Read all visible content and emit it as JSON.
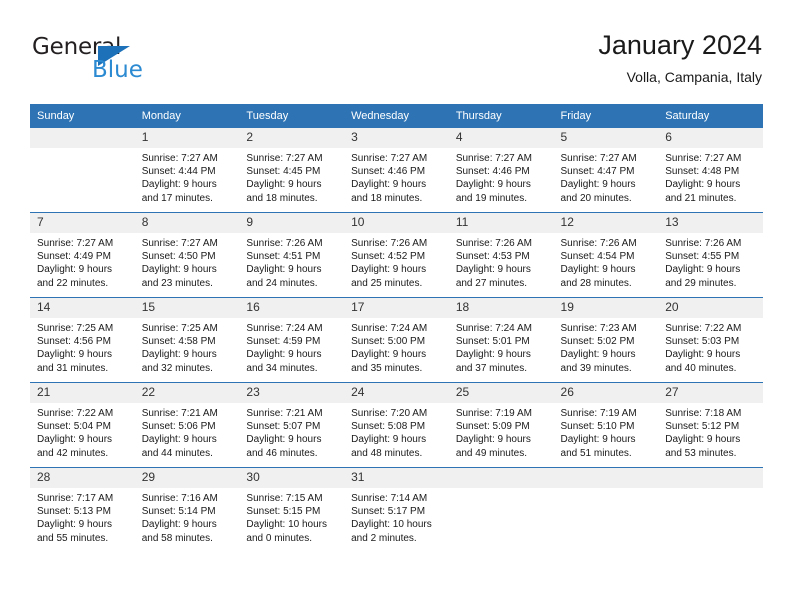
{
  "logo": {
    "word_one": "General",
    "word_two": "Blue",
    "triangle_color": "#1d71b8",
    "blue_color": "#2b8ad1"
  },
  "header": {
    "title": "January 2024",
    "subtitle": "Volla, Campania, Italy",
    "header_bg": "#2e74b5",
    "daynum_bg": "#f0f0f0"
  },
  "weekdays": [
    "Sunday",
    "Monday",
    "Tuesday",
    "Wednesday",
    "Thursday",
    "Friday",
    "Saturday"
  ],
  "weeks": [
    [
      {
        "day": "",
        "lines": []
      },
      {
        "day": "1",
        "lines": [
          "Sunrise: 7:27 AM",
          "Sunset: 4:44 PM",
          "Daylight: 9 hours",
          "and 17 minutes."
        ]
      },
      {
        "day": "2",
        "lines": [
          "Sunrise: 7:27 AM",
          "Sunset: 4:45 PM",
          "Daylight: 9 hours",
          "and 18 minutes."
        ]
      },
      {
        "day": "3",
        "lines": [
          "Sunrise: 7:27 AM",
          "Sunset: 4:46 PM",
          "Daylight: 9 hours",
          "and 18 minutes."
        ]
      },
      {
        "day": "4",
        "lines": [
          "Sunrise: 7:27 AM",
          "Sunset: 4:46 PM",
          "Daylight: 9 hours",
          "and 19 minutes."
        ]
      },
      {
        "day": "5",
        "lines": [
          "Sunrise: 7:27 AM",
          "Sunset: 4:47 PM",
          "Daylight: 9 hours",
          "and 20 minutes."
        ]
      },
      {
        "day": "6",
        "lines": [
          "Sunrise: 7:27 AM",
          "Sunset: 4:48 PM",
          "Daylight: 9 hours",
          "and 21 minutes."
        ]
      }
    ],
    [
      {
        "day": "7",
        "lines": [
          "Sunrise: 7:27 AM",
          "Sunset: 4:49 PM",
          "Daylight: 9 hours",
          "and 22 minutes."
        ]
      },
      {
        "day": "8",
        "lines": [
          "Sunrise: 7:27 AM",
          "Sunset: 4:50 PM",
          "Daylight: 9 hours",
          "and 23 minutes."
        ]
      },
      {
        "day": "9",
        "lines": [
          "Sunrise: 7:26 AM",
          "Sunset: 4:51 PM",
          "Daylight: 9 hours",
          "and 24 minutes."
        ]
      },
      {
        "day": "10",
        "lines": [
          "Sunrise: 7:26 AM",
          "Sunset: 4:52 PM",
          "Daylight: 9 hours",
          "and 25 minutes."
        ]
      },
      {
        "day": "11",
        "lines": [
          "Sunrise: 7:26 AM",
          "Sunset: 4:53 PM",
          "Daylight: 9 hours",
          "and 27 minutes."
        ]
      },
      {
        "day": "12",
        "lines": [
          "Sunrise: 7:26 AM",
          "Sunset: 4:54 PM",
          "Daylight: 9 hours",
          "and 28 minutes."
        ]
      },
      {
        "day": "13",
        "lines": [
          "Sunrise: 7:26 AM",
          "Sunset: 4:55 PM",
          "Daylight: 9 hours",
          "and 29 minutes."
        ]
      }
    ],
    [
      {
        "day": "14",
        "lines": [
          "Sunrise: 7:25 AM",
          "Sunset: 4:56 PM",
          "Daylight: 9 hours",
          "and 31 minutes."
        ]
      },
      {
        "day": "15",
        "lines": [
          "Sunrise: 7:25 AM",
          "Sunset: 4:58 PM",
          "Daylight: 9 hours",
          "and 32 minutes."
        ]
      },
      {
        "day": "16",
        "lines": [
          "Sunrise: 7:24 AM",
          "Sunset: 4:59 PM",
          "Daylight: 9 hours",
          "and 34 minutes."
        ]
      },
      {
        "day": "17",
        "lines": [
          "Sunrise: 7:24 AM",
          "Sunset: 5:00 PM",
          "Daylight: 9 hours",
          "and 35 minutes."
        ]
      },
      {
        "day": "18",
        "lines": [
          "Sunrise: 7:24 AM",
          "Sunset: 5:01 PM",
          "Daylight: 9 hours",
          "and 37 minutes."
        ]
      },
      {
        "day": "19",
        "lines": [
          "Sunrise: 7:23 AM",
          "Sunset: 5:02 PM",
          "Daylight: 9 hours",
          "and 39 minutes."
        ]
      },
      {
        "day": "20",
        "lines": [
          "Sunrise: 7:22 AM",
          "Sunset: 5:03 PM",
          "Daylight: 9 hours",
          "and 40 minutes."
        ]
      }
    ],
    [
      {
        "day": "21",
        "lines": [
          "Sunrise: 7:22 AM",
          "Sunset: 5:04 PM",
          "Daylight: 9 hours",
          "and 42 minutes."
        ]
      },
      {
        "day": "22",
        "lines": [
          "Sunrise: 7:21 AM",
          "Sunset: 5:06 PM",
          "Daylight: 9 hours",
          "and 44 minutes."
        ]
      },
      {
        "day": "23",
        "lines": [
          "Sunrise: 7:21 AM",
          "Sunset: 5:07 PM",
          "Daylight: 9 hours",
          "and 46 minutes."
        ]
      },
      {
        "day": "24",
        "lines": [
          "Sunrise: 7:20 AM",
          "Sunset: 5:08 PM",
          "Daylight: 9 hours",
          "and 48 minutes."
        ]
      },
      {
        "day": "25",
        "lines": [
          "Sunrise: 7:19 AM",
          "Sunset: 5:09 PM",
          "Daylight: 9 hours",
          "and 49 minutes."
        ]
      },
      {
        "day": "26",
        "lines": [
          "Sunrise: 7:19 AM",
          "Sunset: 5:10 PM",
          "Daylight: 9 hours",
          "and 51 minutes."
        ]
      },
      {
        "day": "27",
        "lines": [
          "Sunrise: 7:18 AM",
          "Sunset: 5:12 PM",
          "Daylight: 9 hours",
          "and 53 minutes."
        ]
      }
    ],
    [
      {
        "day": "28",
        "lines": [
          "Sunrise: 7:17 AM",
          "Sunset: 5:13 PM",
          "Daylight: 9 hours",
          "and 55 minutes."
        ]
      },
      {
        "day": "29",
        "lines": [
          "Sunrise: 7:16 AM",
          "Sunset: 5:14 PM",
          "Daylight: 9 hours",
          "and 58 minutes."
        ]
      },
      {
        "day": "30",
        "lines": [
          "Sunrise: 7:15 AM",
          "Sunset: 5:15 PM",
          "Daylight: 10 hours",
          "and 0 minutes."
        ]
      },
      {
        "day": "31",
        "lines": [
          "Sunrise: 7:14 AM",
          "Sunset: 5:17 PM",
          "Daylight: 10 hours",
          "and 2 minutes."
        ]
      },
      {
        "day": "",
        "lines": []
      },
      {
        "day": "",
        "lines": []
      },
      {
        "day": "",
        "lines": []
      }
    ]
  ]
}
